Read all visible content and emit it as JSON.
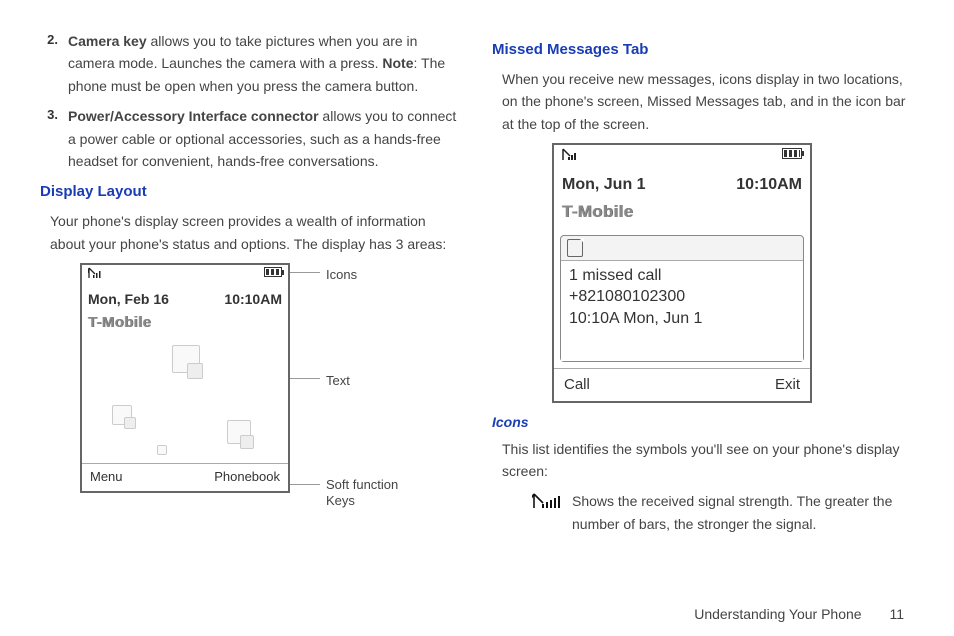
{
  "left": {
    "item2_num": "2.",
    "item2_bold": "Camera key",
    "item2_text": " allows you to take pictures when you are in camera mode. Launches the camera with a press. ",
    "item2_note_label": "Note",
    "item2_note_text": ": The phone must be open when you press the camera button.",
    "item3_num": "3.",
    "item3_bold": "Power/Accessory Interface connector",
    "item3_text": " allows you to connect a power cable or optional accessories, such as a hands-free headset for convenient, hands-free conversations.",
    "display_head": "Display Layout",
    "display_body": "Your phone's display screen provides a wealth of information about your phone's status and options. The display has 3 areas:",
    "screen": {
      "date": "Mon, Feb 16",
      "time": "10:10AM",
      "carrier": "T-Mobile",
      "soft_left": "Menu",
      "soft_right": "Phonebook"
    },
    "labels": {
      "icons": "Icons",
      "text": "Text",
      "softkeys1": "Soft function",
      "softkeys2": "Keys"
    }
  },
  "right": {
    "missed_head": "Missed Messages Tab",
    "missed_body": "When you receive new messages, icons display in two locations, on the phone's screen, Missed Messages tab, and in the icon bar at the top of the screen.",
    "screen": {
      "date": "Mon, Jun 1",
      "time": "10:10AM",
      "carrier": "T-Mobile",
      "m1": "1 missed call",
      "m2": "+821080102300",
      "m3": "10:10A Mon, Jun 1",
      "soft_left": "Call",
      "soft_right": "Exit"
    },
    "icons_head": "Icons",
    "icons_body": "This list identifies the symbols you'll see on your phone's display screen:",
    "signal_desc": "Shows the received signal strength. The greater the number of bars, the stronger the signal."
  },
  "footer": {
    "chapter": "Understanding Your Phone",
    "page": "11"
  }
}
